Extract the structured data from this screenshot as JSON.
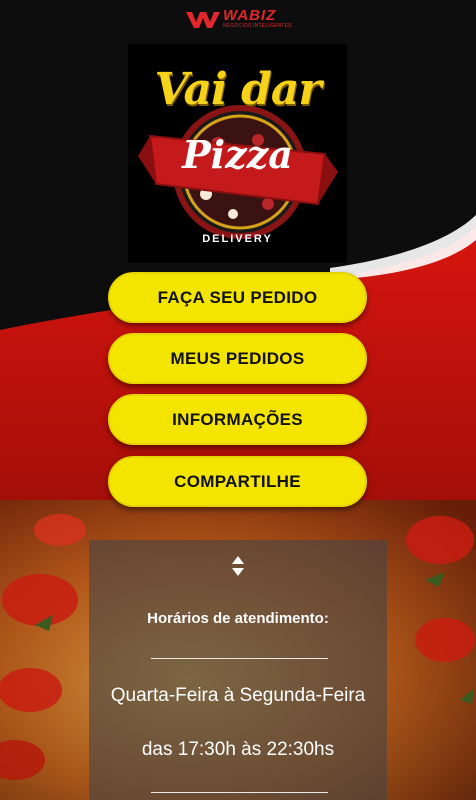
{
  "header": {
    "brand_name": "WABIZ",
    "brand_tagline": "NEGÓCIOS INTELIGENTES"
  },
  "logo": {
    "line1": "Vai dar",
    "line2": "Pizza",
    "line3": "DELIVERY"
  },
  "menu": {
    "order": "FAÇA SEU PEDIDO",
    "my_orders": "MEUS PEDIDOS",
    "info": "INFORMAÇÕES",
    "share": "COMPARTILHE"
  },
  "hours": {
    "title": "Horários de atendimento:",
    "days": "Quarta-Feira à Segunda-Feira",
    "time": "das 17:30h às 22:30hs"
  },
  "colors": {
    "accent_yellow": "#f4e500",
    "brand_red": "#e2262b",
    "background_red": "#c4120f"
  }
}
